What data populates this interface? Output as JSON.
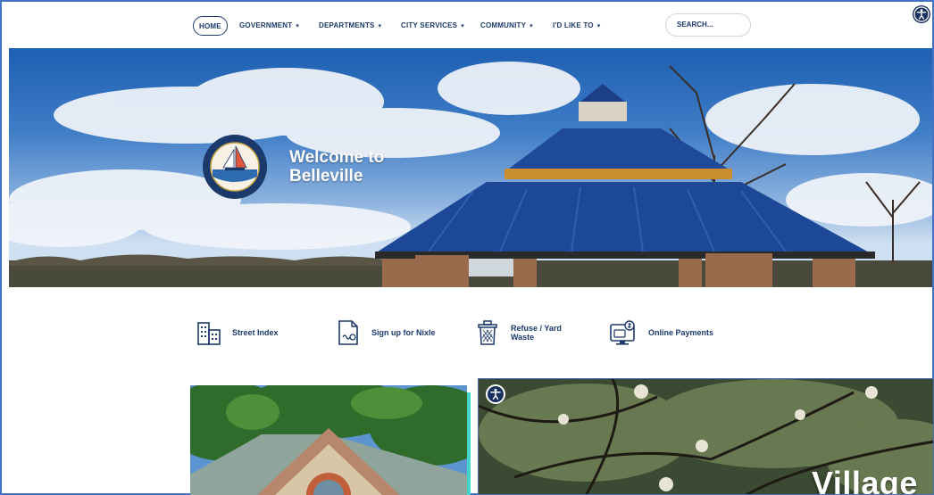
{
  "nav": {
    "items": [
      {
        "label": "HOME",
        "has_caret": false
      },
      {
        "label": "GOVERNMENT",
        "has_caret": true
      },
      {
        "label": "DEPARTMENTS",
        "has_caret": true
      },
      {
        "label": "CITY SERVICES",
        "has_caret": true
      },
      {
        "label": "COMMUNITY",
        "has_caret": true
      },
      {
        "label": "I'D LIKE TO",
        "has_caret": true
      }
    ],
    "caret": "▾",
    "search_placeholder": "SEARCH...",
    "accessibility_icon": "accessibility-icon"
  },
  "hero": {
    "welcome_line1": "Welcome to",
    "welcome_line2": "Belleville",
    "seal_icon": "city-seal-logo",
    "seal_text_top": "CITY OF BELLEVILLE, MICHIGAN",
    "seal_text_bottom": "QUALITY LIVING SINCE 1905"
  },
  "quick_links": [
    {
      "label": "Street Index",
      "icon": "building-map-icon"
    },
    {
      "label": "Sign up for Nixle",
      "icon": "document-signup-icon"
    },
    {
      "label_line1": "Refuse / Yard",
      "label_line2": "Waste",
      "icon": "trash-can-icon"
    },
    {
      "label": "Online Payments",
      "icon": "computer-payment-icon"
    }
  ],
  "panels": {
    "right_title": "Village",
    "right_accessibility_icon": "accessibility-icon"
  },
  "colors": {
    "nav_text": "#1b3a6b",
    "accent_teal": "#43d3c8",
    "frame_blue": "#4472c4"
  }
}
